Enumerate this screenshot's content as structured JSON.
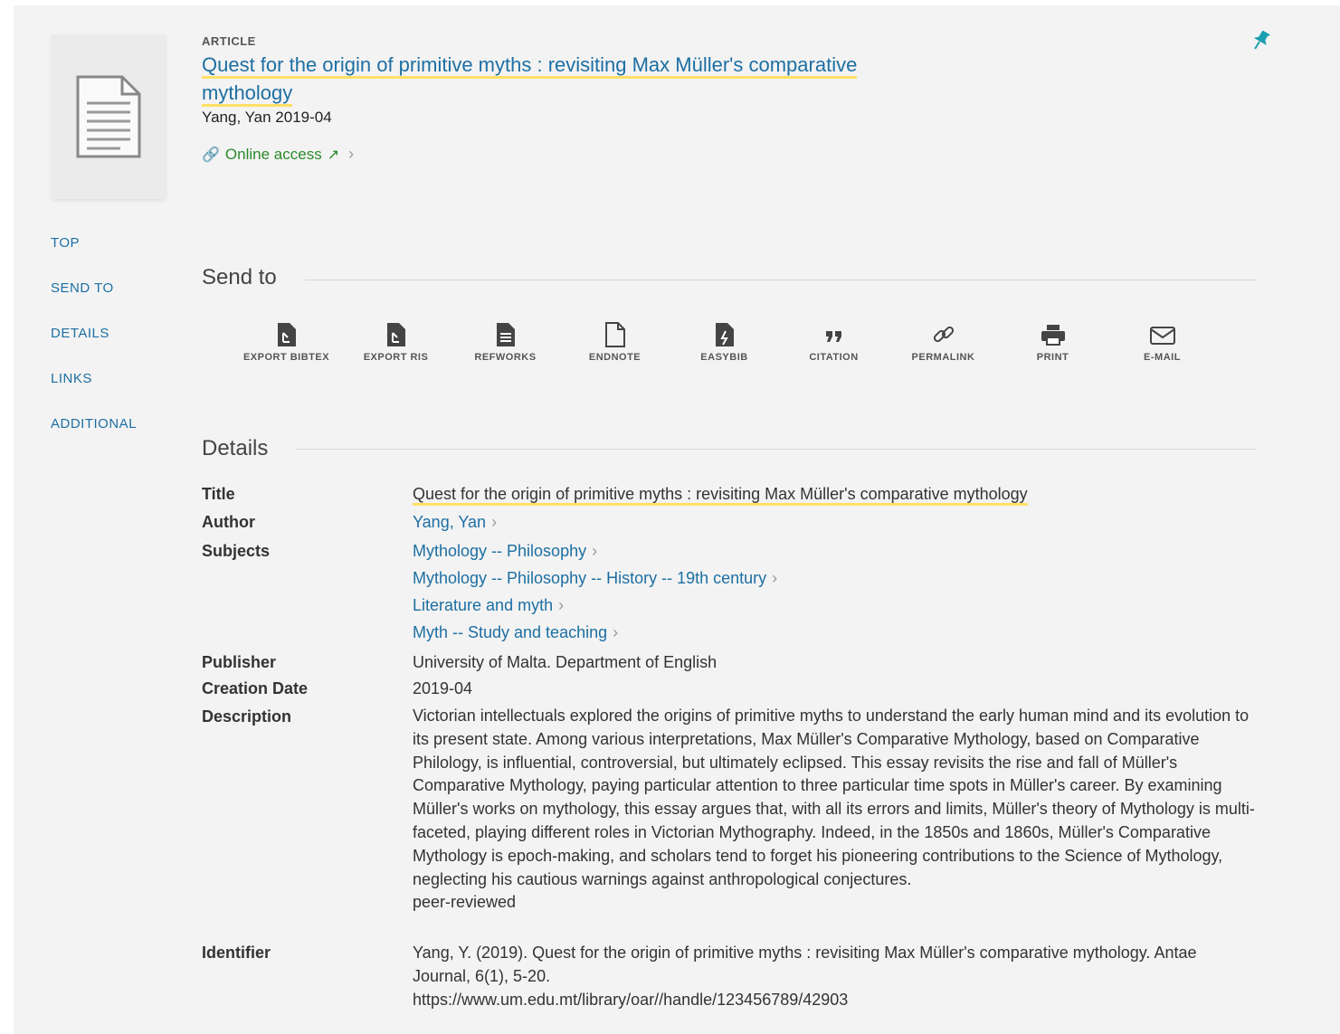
{
  "record": {
    "type": "ARTICLE",
    "title": "Quest for the origin of primitive myths : revisiting Max Müller's comparative mythology",
    "byline": "Yang, Yan 2019-04",
    "online_access": "Online access"
  },
  "nav": {
    "items": [
      "TOP",
      "SEND TO",
      "DETAILS",
      "LINKS",
      "ADDITIONAL"
    ]
  },
  "send_to": {
    "heading": "Send to",
    "actions": [
      {
        "label": "EXPORT BIBTEX",
        "icon": "export-bibtex-icon"
      },
      {
        "label": "EXPORT RIS",
        "icon": "export-ris-icon"
      },
      {
        "label": "REFWORKS",
        "icon": "refworks-icon"
      },
      {
        "label": "ENDNOTE",
        "icon": "endnote-icon"
      },
      {
        "label": "EASYBIB",
        "icon": "easybib-icon"
      },
      {
        "label": "CITATION",
        "icon": "citation-icon"
      },
      {
        "label": "PERMALINK",
        "icon": "permalink-icon"
      },
      {
        "label": "PRINT",
        "icon": "print-icon"
      },
      {
        "label": "E-MAIL",
        "icon": "email-icon"
      }
    ]
  },
  "details": {
    "heading": "Details",
    "labels": {
      "title": "Title",
      "author": "Author",
      "subjects": "Subjects",
      "publisher": "Publisher",
      "creation_date": "Creation Date",
      "description": "Description",
      "identifier": "Identifier"
    },
    "title": "Quest for the origin of primitive myths : revisiting Max Müller's comparative mythology",
    "author": "Yang, Yan",
    "subjects": [
      "Mythology -- Philosophy",
      "Mythology -- Philosophy -- History -- 19th century",
      "Literature and myth",
      "Myth -- Study and teaching"
    ],
    "publisher": "University of Malta. Department of English",
    "creation_date": "2019-04",
    "description": "Victorian intellectuals explored the origins of primitive myths to understand the early human mind and its evolution to its present state. Among various interpretations, Max Müller's Comparative Mythology, based on Comparative Philology, is influential, controversial, but ultimately eclipsed. This essay revisits the rise and fall of Müller's Comparative Mythology, paying particular attention to three particular time spots in Müller's career. By examining Müller's works on mythology, this essay argues that, with all its errors and limits, Müller's theory of Mythology is multi-faceted, playing different roles in Victorian Mythography. Indeed, in the 1850s and 1860s, Müller's Comparative Mythology is epoch-making, and scholars tend to forget his pioneering contributions to the Science of Mythology, neglecting his cautious warnings against anthropological conjectures.",
    "description_note": "peer-reviewed",
    "identifier_citation": "Yang, Y. (2019). Quest for the origin of primitive myths : revisiting Max Müller's comparative mythology. Antae Journal, 6(1), 5-20.",
    "identifier_url": "https://www.um.edu.mt/library/oar//handle/123456789/42903"
  },
  "colors": {
    "link": "#1d6fa3",
    "online": "#2b8a2b",
    "highlight": "#ffe066",
    "pin": "#1a9fb0",
    "background": "#f3f3f3"
  }
}
